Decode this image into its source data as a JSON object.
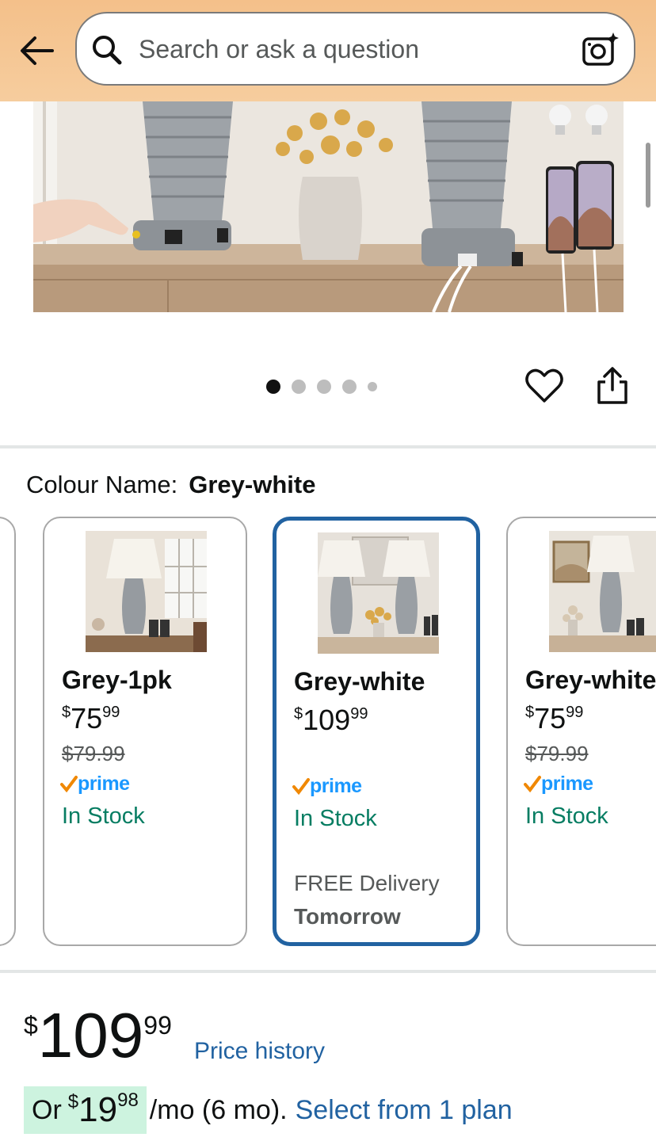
{
  "search": {
    "placeholder": "Search or ask a question"
  },
  "gallery": {
    "image_count": 5,
    "active_index": 0
  },
  "colour": {
    "label": "Colour Name:",
    "value": "Grey-white"
  },
  "swatches": [
    {
      "name": "Grey-1pk",
      "currency": "$",
      "whole": "75",
      "fraction": "99",
      "was": "$79.99",
      "prime": "prime",
      "stock": "In Stock"
    },
    {
      "name": "Grey-white",
      "currency": "$",
      "whole": "109",
      "fraction": "99",
      "prime": "prime",
      "stock": "In Stock",
      "delivery": "FREE Delivery",
      "delivery_day": "Tomorrow",
      "selected": true
    },
    {
      "name": "Grey-white",
      "currency": "$",
      "whole": "75",
      "fraction": "99",
      "was": "$79.99",
      "prime": "prime",
      "stock": "In Stock"
    }
  ],
  "price": {
    "currency": "$",
    "whole": "109",
    "fraction": "99",
    "history_link": "Price history"
  },
  "plan": {
    "prefix": "Or",
    "currency": "$",
    "whole": "19",
    "fraction": "98",
    "suffix": "/mo (6 mo).",
    "link": "Select from 1 plan"
  },
  "colors": {
    "header": "#f4c08a",
    "selected_border": "#2162a1",
    "in_stock": "#067d62",
    "link": "#2162a1",
    "prime_blue": "#1a98ff",
    "prime_check": "#f08804",
    "plan_highlight": "#cdf3df"
  }
}
